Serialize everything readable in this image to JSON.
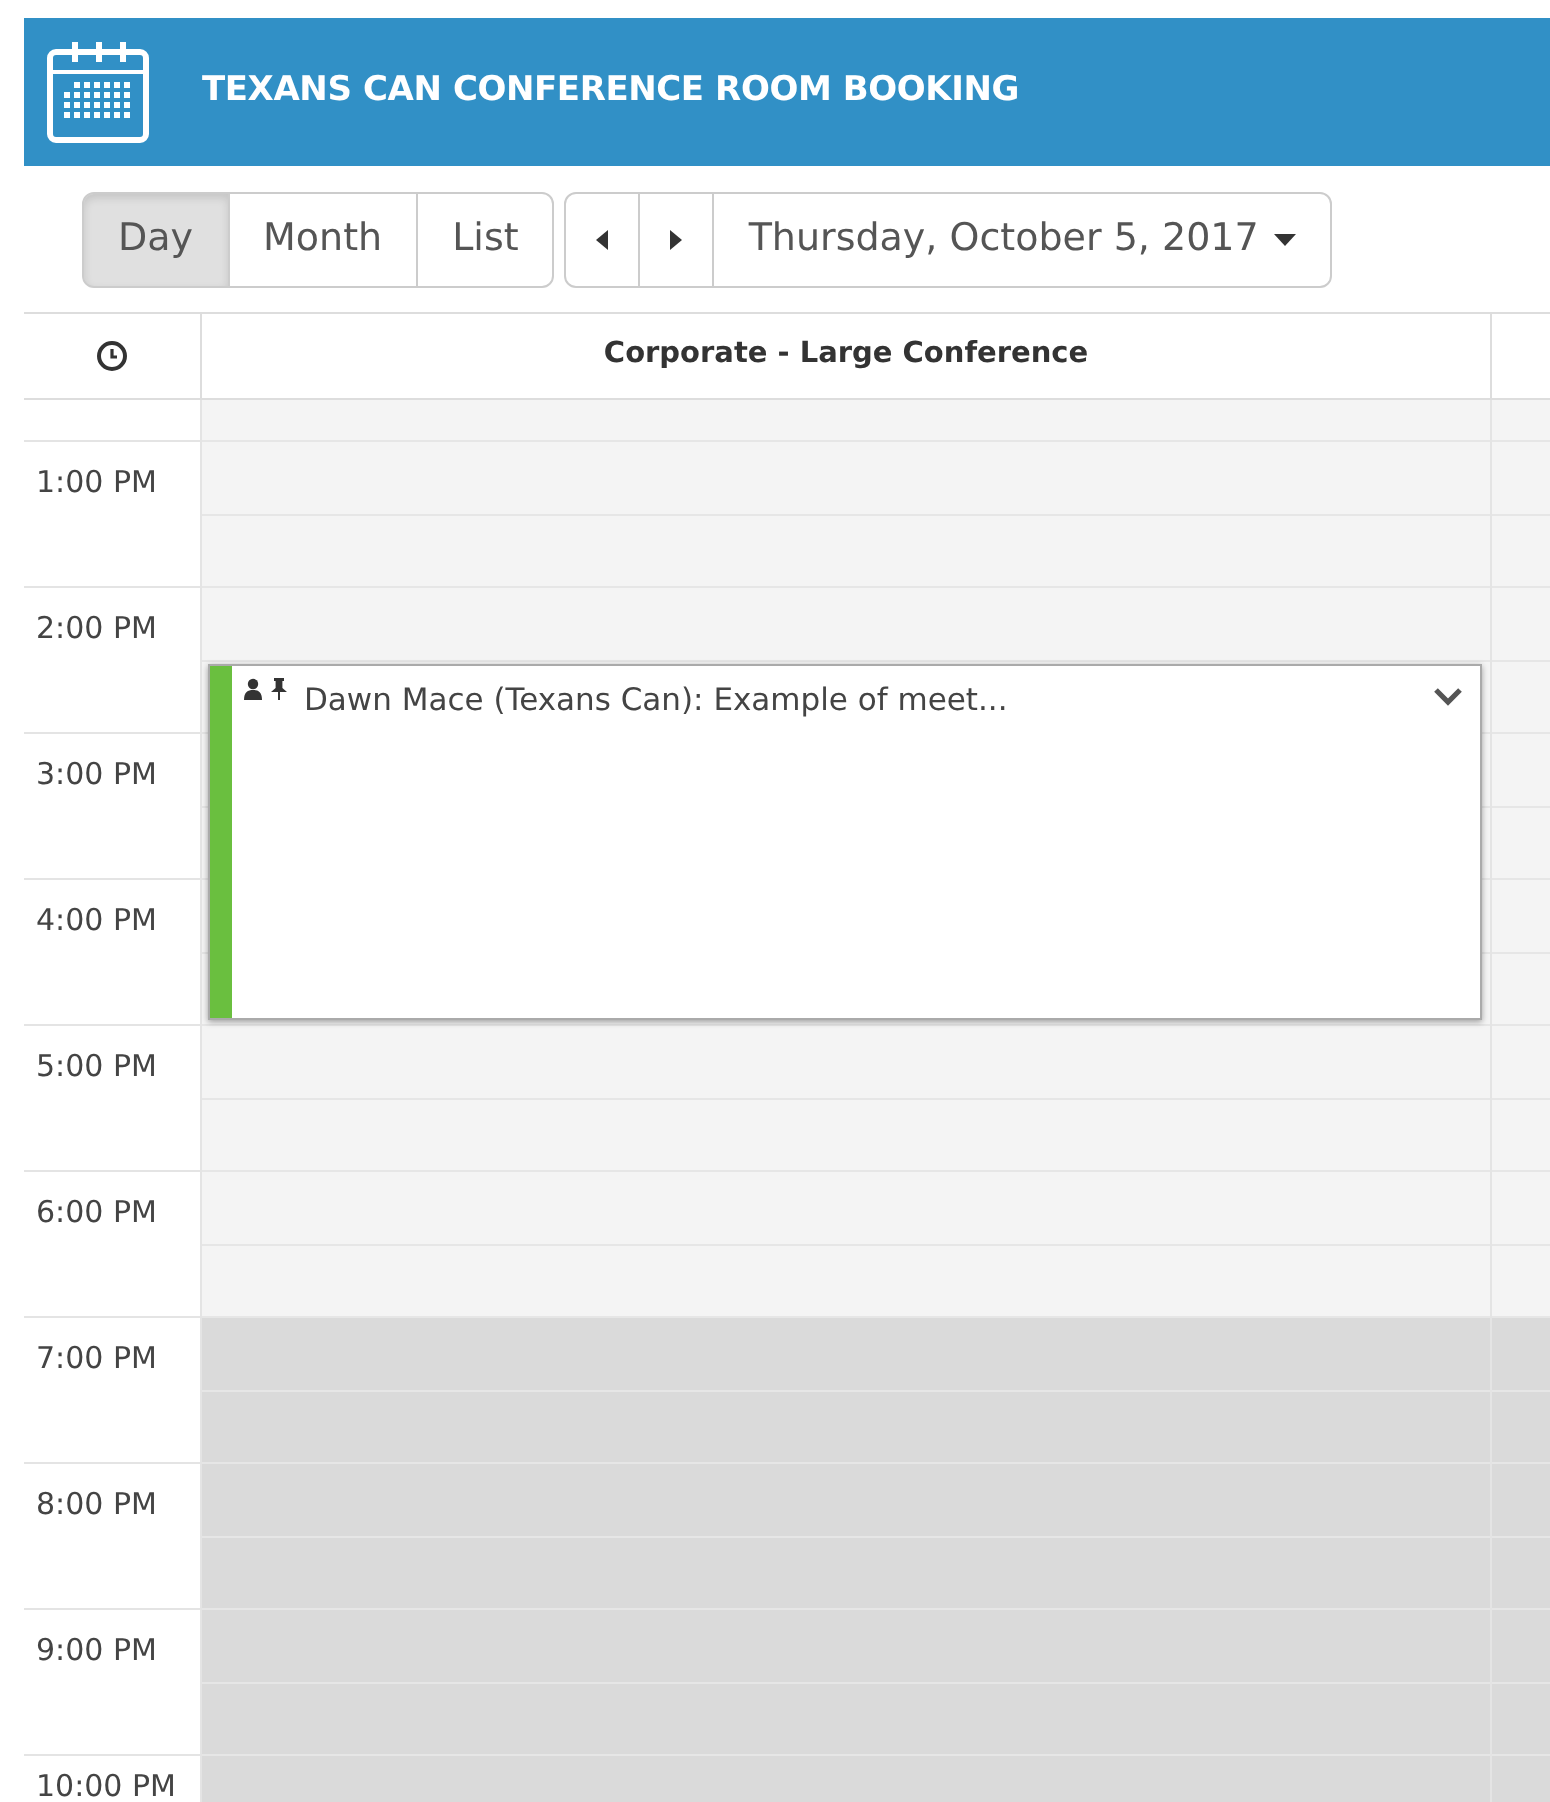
{
  "app_bar": {
    "title": "TEXANS CAN CONFERENCE ROOM BOOKING"
  },
  "view_buttons": [
    {
      "label": "Day",
      "selected": true
    },
    {
      "label": "Month",
      "selected": false
    },
    {
      "label": "List",
      "selected": false
    }
  ],
  "date_picker": {
    "label": "Thursday, October 5, 2017"
  },
  "columns": [
    "Corporate - Large Conference"
  ],
  "hours": [
    {
      "label": "1:00 PM",
      "off_hours": false
    },
    {
      "label": "2:00 PM",
      "off_hours": false,
      "events": [
        {
          "title": "Dawn Mace (Texans Can): Example of meet...",
          "color": "#6abf3f"
        }
      ]
    },
    {
      "label": "3:00 PM",
      "off_hours": false
    },
    {
      "label": "4:00 PM",
      "off_hours": false
    },
    {
      "label": "5:00 PM",
      "off_hours": false
    },
    {
      "label": "6:00 PM",
      "off_hours": false
    },
    {
      "label": "7:00 PM",
      "off_hours": true
    },
    {
      "label": "8:00 PM",
      "off_hours": true
    },
    {
      "label": "9:00 PM",
      "off_hours": true
    },
    {
      "label": "10:00 PM",
      "off_hours": true
    }
  ]
}
